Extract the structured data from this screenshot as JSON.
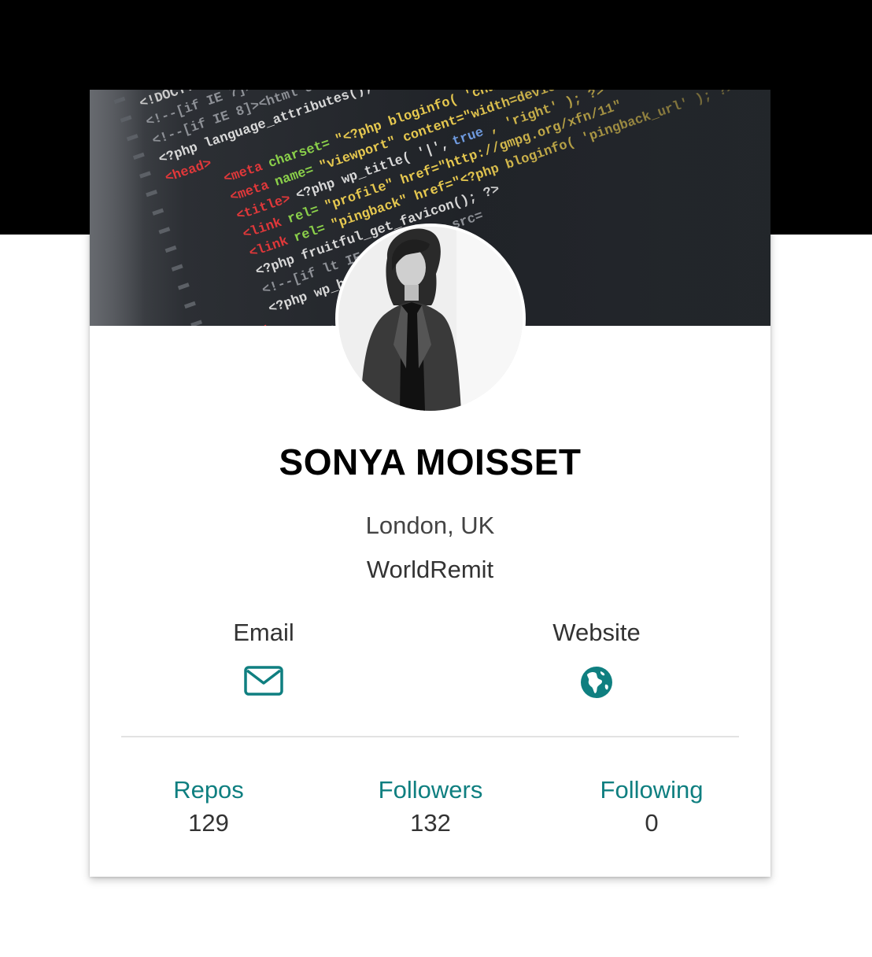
{
  "colors": {
    "accent": "#0f7f80",
    "header_band": "#000000",
    "card_background": "#ffffff",
    "text": "#333333"
  },
  "cover": {
    "image": "code-editor-screenshot"
  },
  "avatar": {
    "image": "profile-photo"
  },
  "profile": {
    "name": "SONYA MOISSET",
    "location": "London, UK",
    "company": "WorldRemit"
  },
  "contacts": {
    "email": {
      "label": "Email",
      "icon": "envelope-icon"
    },
    "website": {
      "label": "Website",
      "icon": "globe-icon"
    }
  },
  "stats": {
    "repos": {
      "label": "Repos",
      "value": "129"
    },
    "followers": {
      "label": "Followers",
      "value": "132"
    },
    "following": {
      "label": "Following",
      "value": "0"
    }
  }
}
